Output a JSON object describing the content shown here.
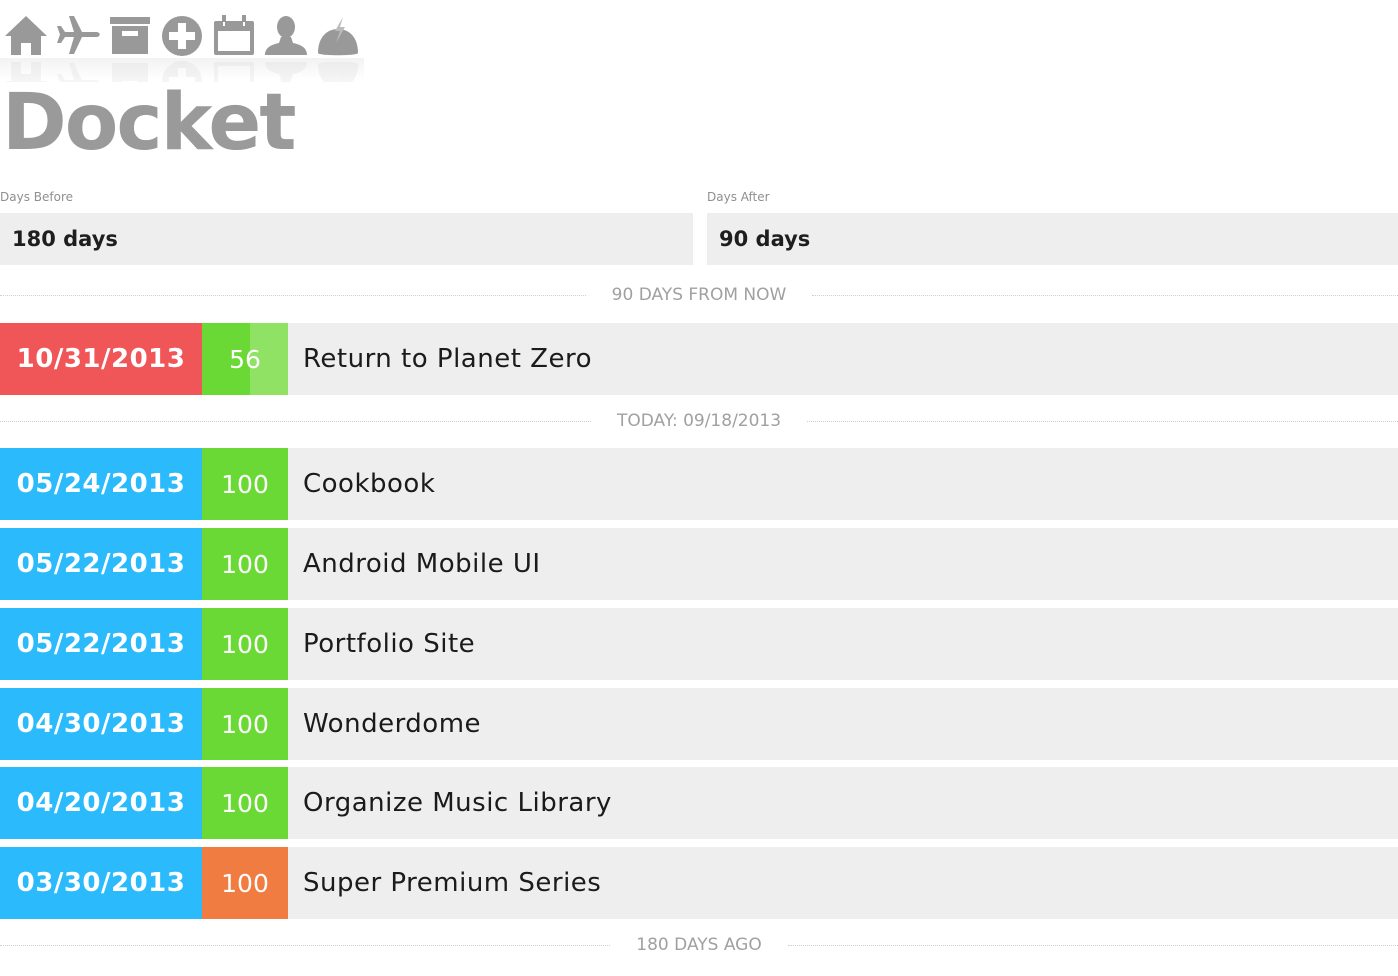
{
  "nav": {
    "icons": [
      {
        "name": "home-icon",
        "label": "Home"
      },
      {
        "name": "airplane-icon",
        "label": "Travel"
      },
      {
        "name": "archive-icon",
        "label": "Archive"
      },
      {
        "name": "add-icon",
        "label": "Add"
      },
      {
        "name": "calendar-icon",
        "label": "Calendar"
      },
      {
        "name": "user-icon",
        "label": "User"
      },
      {
        "name": "alert-dome-icon",
        "label": "Alerts"
      }
    ],
    "icon_color": "#999999"
  },
  "header": {
    "title": "Docket"
  },
  "filters": {
    "days_before_label": "Days Before",
    "days_before_value": "180 days",
    "days_after_label": "Days After",
    "days_after_value": "90 days"
  },
  "dividers": {
    "future": "90 DAYS FROM NOW",
    "today": "TODAY: 09/18/2013",
    "past": "180 DAYS AGO"
  },
  "colors": {
    "overdue": "#f05558",
    "past": "#2bbbfd",
    "progress_done": "#6bd935",
    "progress_remaining": "#8fe263",
    "progress_warning": "#f07c42",
    "row_bg": "#eeeeee"
  },
  "upcoming": [
    {
      "date": "10/31/2013",
      "progress": 56,
      "title": "Return to Planet Zero",
      "date_color": "#f05558",
      "progress_color": "#6bd935",
      "progress_bg": "#8fe263"
    }
  ],
  "completed": [
    {
      "date": "05/24/2013",
      "progress": 100,
      "title": "Cookbook",
      "date_color": "#2bbbfd",
      "progress_color": "#6bd935",
      "progress_bg": "#6bd935"
    },
    {
      "date": "05/22/2013",
      "progress": 100,
      "title": "Android Mobile UI",
      "date_color": "#2bbbfd",
      "progress_color": "#6bd935",
      "progress_bg": "#6bd935"
    },
    {
      "date": "05/22/2013",
      "progress": 100,
      "title": "Portfolio Site",
      "date_color": "#2bbbfd",
      "progress_color": "#6bd935",
      "progress_bg": "#6bd935"
    },
    {
      "date": "04/30/2013",
      "progress": 100,
      "title": "Wonderdome",
      "date_color": "#2bbbfd",
      "progress_color": "#6bd935",
      "progress_bg": "#6bd935"
    },
    {
      "date": "04/20/2013",
      "progress": 100,
      "title": "Organize Music Library",
      "date_color": "#2bbbfd",
      "progress_color": "#6bd935",
      "progress_bg": "#6bd935"
    },
    {
      "date": "03/30/2013",
      "progress": 100,
      "title": "Super Premium Series",
      "date_color": "#2bbbfd",
      "progress_color": "#f07c42",
      "progress_bg": "#f07c42"
    }
  ]
}
